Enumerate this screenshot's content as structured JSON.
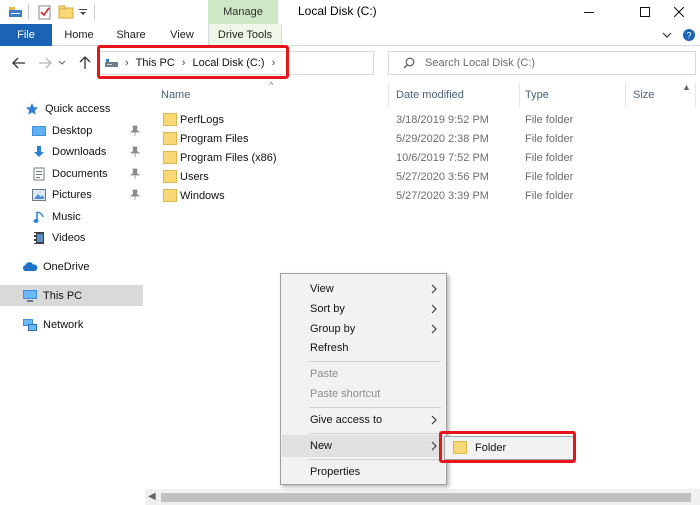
{
  "window": {
    "title": "Local Disk (C:)",
    "manage_tab": "Manage"
  },
  "ribbon": {
    "tabs": [
      "File",
      "Home",
      "Share",
      "View",
      "Drive Tools"
    ]
  },
  "address": {
    "crumbs": [
      "This PC",
      "Local Disk (C:)"
    ],
    "search_placeholder": "Search Local Disk (C:)"
  },
  "nav": {
    "items": [
      {
        "label": "Quick access",
        "icon": "star-icon"
      },
      {
        "label": "Desktop",
        "icon": "desktop-icon",
        "pinned": true
      },
      {
        "label": "Downloads",
        "icon": "download-icon",
        "pinned": true
      },
      {
        "label": "Documents",
        "icon": "document-icon",
        "pinned": true
      },
      {
        "label": "Pictures",
        "icon": "pictures-icon",
        "pinned": true
      },
      {
        "label": "Music",
        "icon": "music-icon"
      },
      {
        "label": "Videos",
        "icon": "video-icon"
      },
      {
        "label": "OneDrive",
        "icon": "cloud-icon"
      },
      {
        "label": "This PC",
        "icon": "computer-icon",
        "selected": true
      },
      {
        "label": "Network",
        "icon": "network-icon"
      }
    ]
  },
  "columns": {
    "name": "Name",
    "date": "Date modified",
    "type": "Type",
    "size": "Size"
  },
  "files": [
    {
      "name": "PerfLogs",
      "date": "3/18/2019 9:52 PM",
      "type": "File folder"
    },
    {
      "name": "Program Files",
      "date": "5/29/2020 2:38 PM",
      "type": "File folder"
    },
    {
      "name": "Program Files (x86)",
      "date": "10/6/2019 7:52 PM",
      "type": "File folder"
    },
    {
      "name": "Users",
      "date": "5/27/2020 3:56 PM",
      "type": "File folder"
    },
    {
      "name": "Windows",
      "date": "5/27/2020 3:39 PM",
      "type": "File folder"
    }
  ],
  "context_menu": {
    "items": [
      {
        "label": "View",
        "submenu": true
      },
      {
        "label": "Sort by",
        "submenu": true
      },
      {
        "label": "Group by",
        "submenu": true
      },
      {
        "label": "Refresh"
      },
      {
        "label": "Paste",
        "disabled": true
      },
      {
        "label": "Paste shortcut",
        "disabled": true
      },
      {
        "label": "Give access to",
        "submenu": true
      },
      {
        "label": "New",
        "submenu": true,
        "hover": true
      },
      {
        "label": "Properties"
      }
    ]
  },
  "submenu": {
    "folder_label": "Folder"
  },
  "colors": {
    "accent": "#1a63b5",
    "manage_tab": "#cfe7c4",
    "highlight": "#e8141c",
    "folder": "#f8d775"
  }
}
